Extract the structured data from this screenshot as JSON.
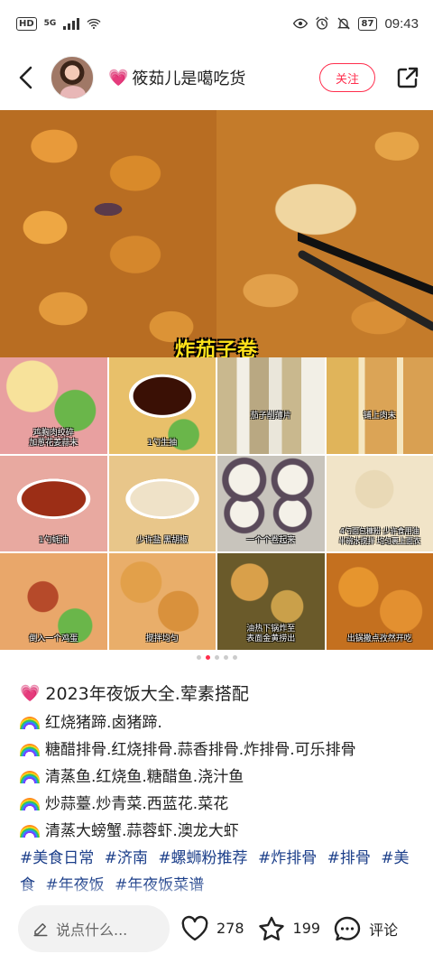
{
  "status_bar": {
    "hd_label": "HD",
    "signal_label": "5G",
    "battery": "87",
    "time": "09:43"
  },
  "header": {
    "author_name": "筱茹儿是噶吃货",
    "follow_label": "关注"
  },
  "media": {
    "top_caption": "炸茄子卷",
    "grid_captions": [
      "鸡胸肉绞碎\n加葱花姜蒜末",
      "1勺生抽",
      "茄子削薄片",
      "铺上肉末",
      "1勺蚝油",
      "少许盐 黑胡椒",
      "一个个卷起来",
      "4勺面包糠粉 少许食用油\n半碗水搅拌 均匀裹上面衣",
      "倒入一个鸡蛋",
      "搅拌均匀",
      "油热下锅炸至\n表面金黄捞出",
      "出锅撒点孜然开吃"
    ],
    "page_indicator": {
      "total": 5,
      "current": 2
    }
  },
  "post": {
    "title": "2023年夜饭大全.荤素搭配",
    "lines": [
      "红烧猪蹄.卤猪蹄.",
      "糖醋排骨.红烧排骨.蒜香排骨.炸排骨.可乐排骨",
      "清蒸鱼.红烧鱼.糖醋鱼.浇汁鱼",
      "炒蒜薹.炒青菜.西蓝花.菜花",
      "清蒸大螃蟹.蒜蓉虾.澳龙大虾"
    ],
    "tags": [
      "#美食日常",
      "#济南",
      "#螺蛳粉推荐",
      "#炸排骨",
      "#排骨",
      "#美食",
      "#年夜饭",
      "#年夜饭菜谱"
    ]
  },
  "bottom_bar": {
    "comment_placeholder": "说点什么...",
    "like_count": "278",
    "collect_count": "199",
    "comment_label": "评论"
  },
  "colors": {
    "accent": "#ff2e4d",
    "tag": "#1c3f8a",
    "caption_yellow": "#ffe21a"
  }
}
